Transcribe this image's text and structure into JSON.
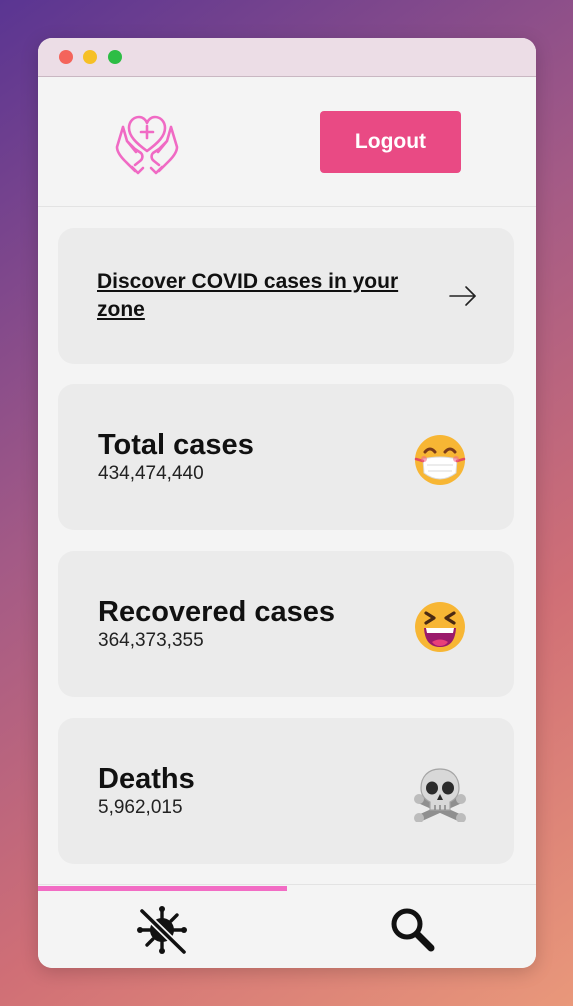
{
  "window": {
    "buttons": [
      "close",
      "minimize",
      "maximize"
    ]
  },
  "header": {
    "logo_icon": "heart-hands-icon",
    "logout_label": "Logout",
    "accent_color": "#e94a84"
  },
  "discover": {
    "label": "Discover COVID cases in your zone",
    "icon": "arrow-right-icon"
  },
  "stats": [
    {
      "title": "Total cases",
      "value": "434,474,440",
      "icon": "face-with-medical-mask-emoji"
    },
    {
      "title": "Recovered cases",
      "value": "364,373,355",
      "icon": "grinning-squinting-face-emoji"
    },
    {
      "title": "Deaths",
      "value": "5,962,015",
      "icon": "skull-and-crossbones-emoji"
    }
  ],
  "bottom_nav": {
    "tabs": [
      {
        "name": "virus",
        "icon": "virus-crossed-icon",
        "active": true
      },
      {
        "name": "search",
        "icon": "search-icon",
        "active": false
      }
    ],
    "indicator_color": "#f26cc4"
  }
}
